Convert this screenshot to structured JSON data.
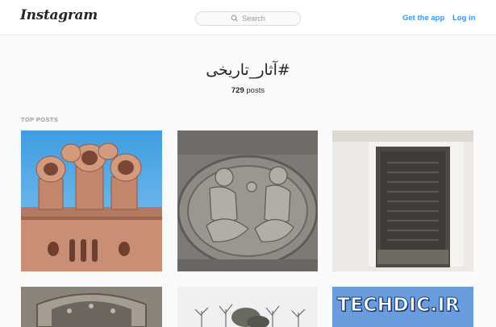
{
  "header": {
    "logo_text": "Instagram",
    "search_placeholder": "Search",
    "get_app_label": "Get the app",
    "login_label": "Log in"
  },
  "hashtag": {
    "title": "#آثار_تاریخی",
    "post_count": "729",
    "post_count_suffix": " posts"
  },
  "section": {
    "title": "TOP POSTS"
  },
  "watermark": {
    "text": "TECHDIC.IR"
  },
  "colors": {
    "link": "#3897f0",
    "background": "#fafafa",
    "header_bg": "#ffffff",
    "border": "#e6e6e6"
  }
}
